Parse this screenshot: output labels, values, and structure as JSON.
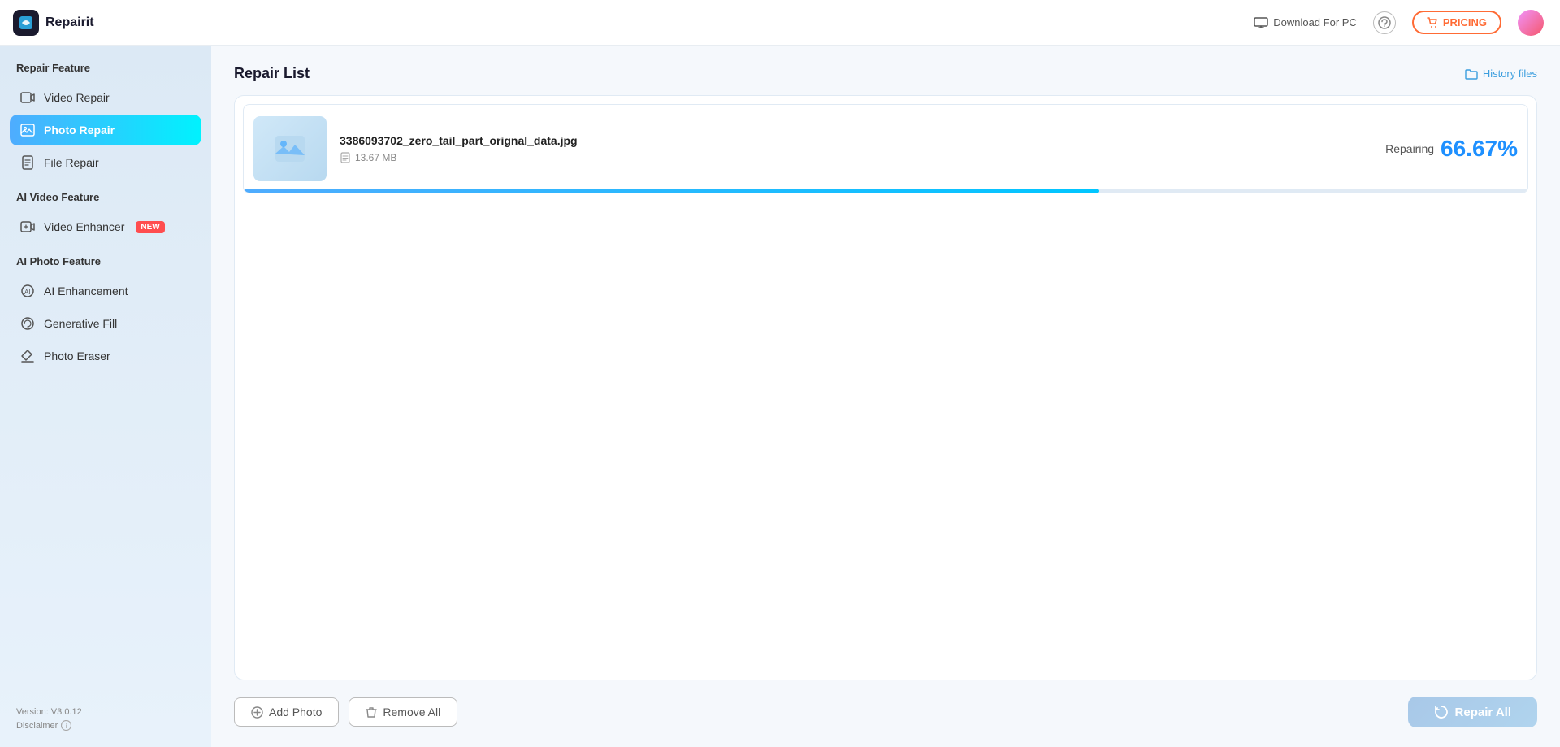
{
  "header": {
    "logo_text": "Repairit",
    "download_label": "Download For PC",
    "pricing_label": "PRICING",
    "help_symbol": "?"
  },
  "sidebar": {
    "repair_feature_title": "Repair Feature",
    "items_repair": [
      {
        "id": "video-repair",
        "label": "Video Repair",
        "icon": "▶",
        "active": false
      },
      {
        "id": "photo-repair",
        "label": "Photo Repair",
        "icon": "🖼",
        "active": true
      }
    ],
    "file_repair_item": {
      "id": "file-repair",
      "label": "File Repair",
      "icon": "📄"
    },
    "ai_video_feature_title": "AI Video Feature",
    "items_ai_video": [
      {
        "id": "video-enhancer",
        "label": "Video Enhancer",
        "icon": "🎥",
        "badge": "NEW"
      }
    ],
    "ai_photo_feature_title": "AI Photo Feature",
    "items_ai_photo": [
      {
        "id": "ai-enhancement",
        "label": "AI Enhancement",
        "icon": "✨"
      },
      {
        "id": "generative-fill",
        "label": "Generative Fill",
        "icon": "🎨"
      },
      {
        "id": "photo-eraser",
        "label": "Photo Eraser",
        "icon": "◇"
      }
    ],
    "version_text": "Version: V3.0.12",
    "disclaimer_text": "Disclaimer"
  },
  "main": {
    "repair_list_title": "Repair List",
    "history_files_label": "History files",
    "files": [
      {
        "name": "3386093702_zero_tail_part_orignal_data.jpg",
        "size": "13.67 MB",
        "status": "Repairing",
        "progress_percent": "66.67%",
        "progress_value": 66.67
      }
    ],
    "add_photo_label": "Add Photo",
    "remove_all_label": "Remove All",
    "repair_all_label": "Repair All"
  }
}
